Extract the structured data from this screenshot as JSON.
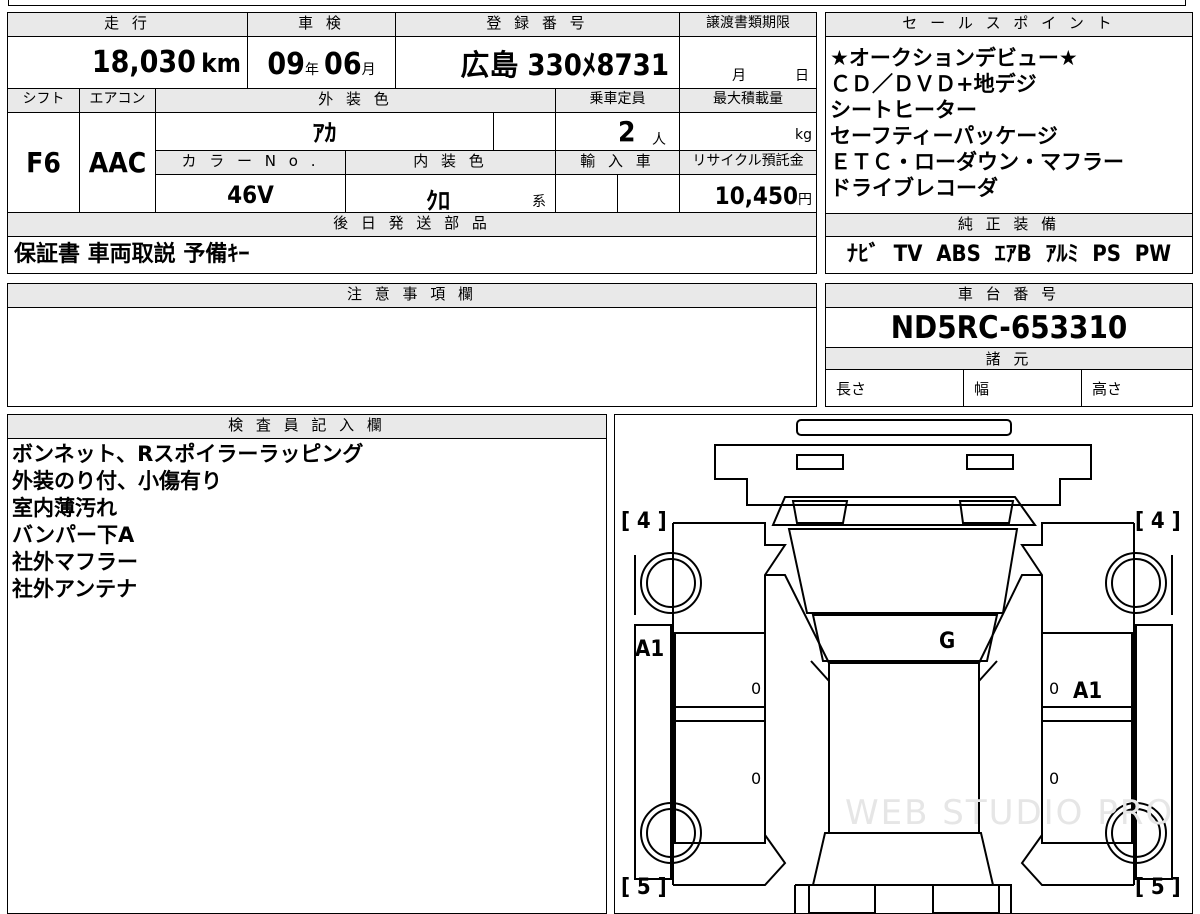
{
  "header": {
    "mileage_label": "走 行",
    "shaken_label": "車 検",
    "reg_label": "登 録 番 号",
    "transfer_label": "譲渡書類期限",
    "sales_label": "セ ー ル ス ポ イ ン ト"
  },
  "values": {
    "mileage": "18,030",
    "mileage_unit": "km",
    "shaken_year": "09",
    "year_unit": "年",
    "shaken_month": "06",
    "month_unit": "月",
    "reg_number": "広島 330ﾒ8731",
    "transfer_month": "月",
    "transfer_day": "日"
  },
  "row2": {
    "shift_label": "シフト",
    "ac_label": "エアコン",
    "color_label": "外 装 色",
    "capacity_label": "乗車定員",
    "load_label": "最大積載量",
    "shift": "F6",
    "ac": "AAC",
    "color": "ｱｶ",
    "capacity": "2",
    "capacity_unit": "人",
    "load_unit": "kg",
    "color_no_label": "カ ラ ー N o .",
    "interior_label": "内 装 色",
    "import_label": "輸 入 車",
    "recycle_label": "リサイクル預託金",
    "color_no": "46V",
    "interior": "ｸﾛ",
    "interior_unit": "系",
    "recycle": "10,450",
    "yen": "円"
  },
  "parts": {
    "label": "後 日 発 送 部 品",
    "value": "保証書 車両取説 予備ｷｰ"
  },
  "caution": {
    "label": "注 意 事 項 欄"
  },
  "sales_points": [
    "★オークションデビュー★",
    "ＣＤ／ＤＶＤ+地デジ",
    "シートヒーター",
    "セーフティーパッケージ",
    "ＥＴＣ・ローダウン・マフラー",
    "ドライブレコーダ"
  ],
  "equipment": {
    "label": "純 正 装 備",
    "value": "ﾅﾋﾞ  TV  ABS  ｴｱB  ｱﾙﾐ  PS  PW"
  },
  "chassis": {
    "label": "車 台 番 号",
    "value": "ND5RC-653310",
    "spec_label": "諸 元",
    "length": "長さ",
    "width": "幅",
    "height": "高さ"
  },
  "inspector": {
    "label": "検 査 員 記 入 欄",
    "lines": [
      "ボンネット、Rスポイラーラッピング",
      "外装のり付、小傷有り",
      "室内薄汚れ",
      "バンパー下A",
      "社外マフラー",
      "社外アンテナ"
    ]
  },
  "diagram": {
    "tl": "[ 4 ]",
    "tr": "[ 4 ]",
    "bl": "[ 5 ]",
    "br": "[ 5 ]",
    "a1_left": "A1",
    "a1_right": "A1",
    "g": "G",
    "zero": "0",
    "watermark": "WEB STUDIO PRO"
  }
}
